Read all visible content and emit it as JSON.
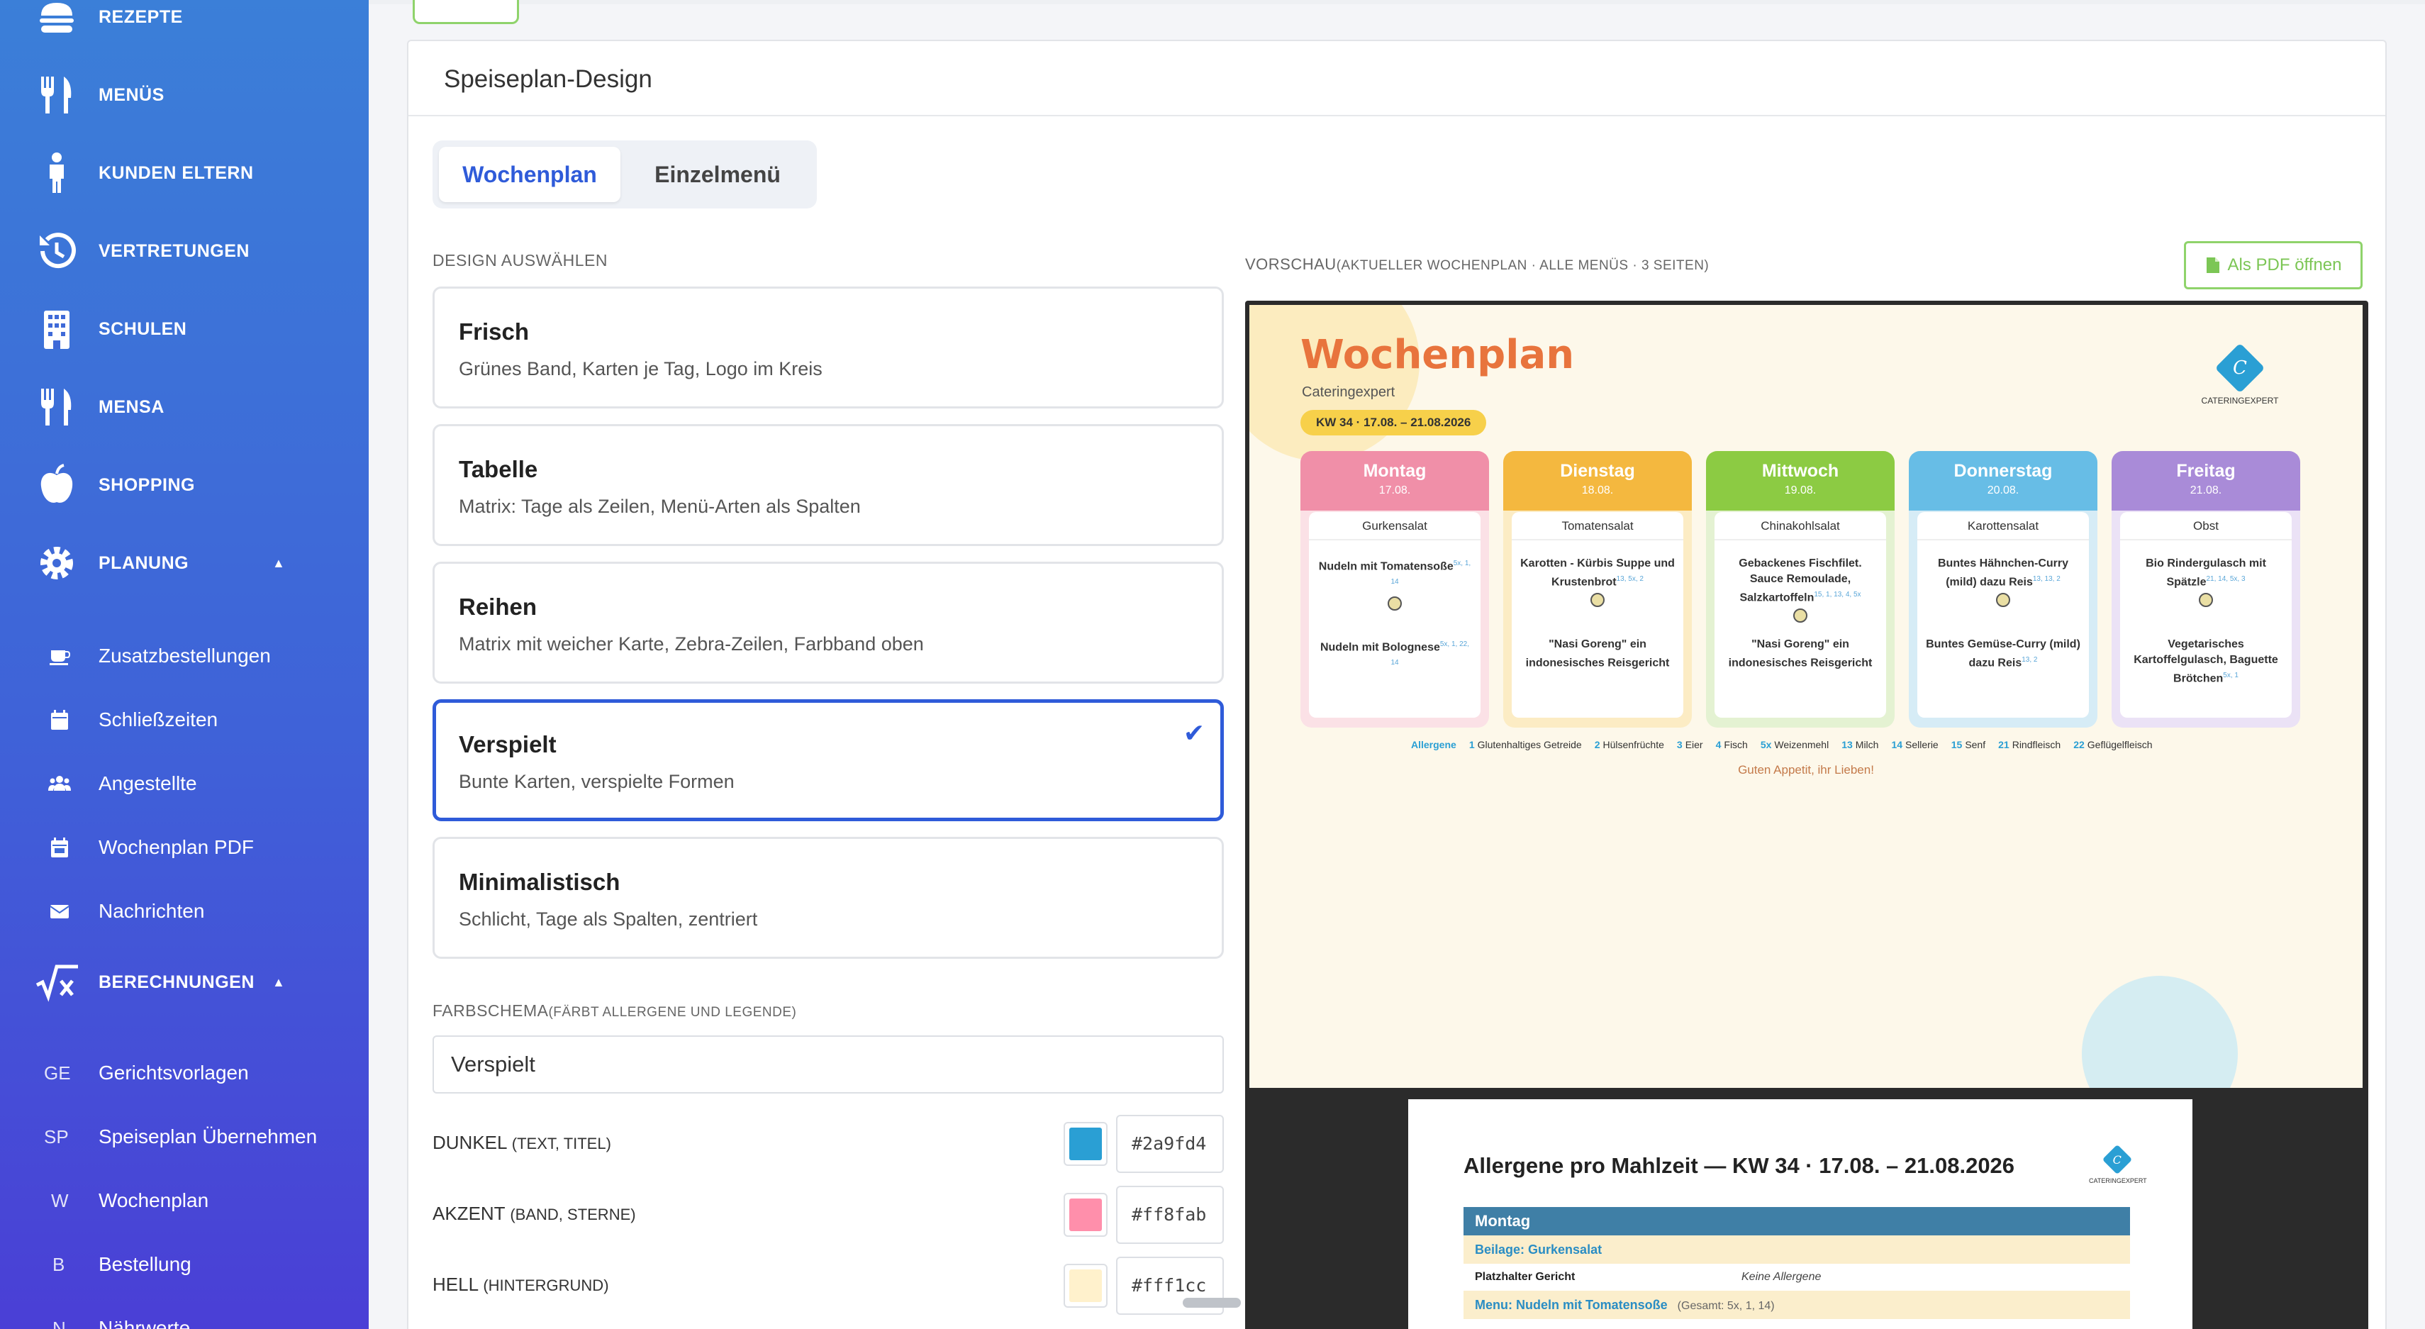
{
  "sidebar": {
    "top_items": [
      {
        "label": "REZEPTE",
        "icon": "burger-icon"
      },
      {
        "label": "MENÜS",
        "icon": "fork-knife-icon"
      },
      {
        "label": "KUNDEN ELTERN",
        "icon": "child-icon"
      },
      {
        "label": "VERTRETUNGEN",
        "icon": "history-icon"
      },
      {
        "label": "SCHULEN",
        "icon": "building-icon"
      },
      {
        "label": "MENSA",
        "icon": "fork-knife-icon"
      },
      {
        "label": "SHOPPING",
        "icon": "apple-icon"
      },
      {
        "label": "PLANUNG",
        "icon": "gear-icon"
      }
    ],
    "planung_items": [
      {
        "label": "Zusatzbestellungen",
        "icon": "cup-icon"
      },
      {
        "label": "Schließzeiten",
        "icon": "calendar-icon"
      },
      {
        "label": "Angestellte",
        "icon": "users-icon"
      },
      {
        "label": "Wochenplan PDF",
        "icon": "calendar-icon"
      },
      {
        "label": "Nachrichten",
        "icon": "envelope-icon"
      }
    ],
    "berechnungen": {
      "label": "BERECHNUNGEN",
      "icon": "sqrt-x-icon"
    },
    "berechnungen_items": [
      {
        "abbr": "GE",
        "label": "Gerichtsvorlagen"
      },
      {
        "abbr": "SP",
        "label": "Speiseplan Übernehmen"
      },
      {
        "abbr": "W",
        "label": "Wochenplan"
      },
      {
        "abbr": "B",
        "label": "Bestellung"
      },
      {
        "abbr": "N",
        "label": "Nährwerte"
      }
    ]
  },
  "card": {
    "title": "Speiseplan-Design",
    "tabs": {
      "wochenplan": "Wochenplan",
      "einzelmenu": "Einzelmenü"
    },
    "design_label": "DESIGN AUSWÄHLEN",
    "designs": [
      {
        "name": "Frisch",
        "desc": "Grünes Band, Karten je Tag, Logo im Kreis"
      },
      {
        "name": "Tabelle",
        "desc": "Matrix: Tage als Zeilen, Menü-Arten als Spalten"
      },
      {
        "name": "Reihen",
        "desc": "Matrix mit weicher Karte, Zebra-Zeilen, Farbband oben"
      },
      {
        "name": "Verspielt",
        "desc": "Bunte Karten, verspielte Formen",
        "check": "✔"
      },
      {
        "name": "Minimalistisch",
        "desc": "Schlicht, Tage als Spalten, zentriert"
      }
    ],
    "farbschema_label": "FARBSCHEMA",
    "farbschema_hint": "(FÄRBT ALLERGENE UND LEGENDE)",
    "farbschema_value": "Verspielt",
    "colors": [
      {
        "label": "DUNKEL",
        "hint": "(TEXT, TITEL)",
        "hex": "#2a9fd4"
      },
      {
        "label": "AKZENT",
        "hint": "(BAND, STERNE)",
        "hex": "#ff8fab"
      },
      {
        "label": "HELL",
        "hint": "(HINTERGRUND)",
        "hex": "#fff1cc"
      }
    ]
  },
  "preview": {
    "label": "VORSCHAU",
    "hint": "(AKTUELLER WOCHENPLAN · ALLE MENÜS · 3 SEITEN)",
    "pdf_button": "Als PDF öffnen",
    "page1": {
      "title": "Wochenplan",
      "subtitle": "Cateringexpert",
      "kw": "KW 34 · 17.08. – 21.08.2026",
      "logo_letter": "C",
      "logo_text": "CATERINGEXPERT",
      "days": [
        {
          "name": "Montag",
          "date": "17.08.",
          "color": "#f08fa8",
          "bg": "#fbe1e6",
          "side": "Gurkensalat",
          "meal1": "Nudeln mit Tomatensoße",
          "meal1_allergens": "5x, 1, 14",
          "meal2": "Nudeln mit Bolognese",
          "meal2_allergens": "5x, 1, 22, 14"
        },
        {
          "name": "Dienstag",
          "date": "18.08.",
          "color": "#f4b83f",
          "bg": "#fcecc4",
          "side": "Tomatensalat",
          "meal1": "Karotten - Kürbis Suppe und Krustenbrot",
          "meal1_allergens": "13, 5x, 2",
          "meal2": "\"Nasi Goreng\" ein indonesisches Reisgericht",
          "meal2_allergens": ""
        },
        {
          "name": "Mittwoch",
          "date": "19.08.",
          "color": "#8ccb43",
          "bg": "#e4f2d2",
          "side": "Chinakohlsalat",
          "meal1": "Gebackenes Fischfilet. Sauce Remoulade, Salzkartoffeln",
          "meal1_allergens": "15, 1, 13, 4, 5x",
          "meal2": "\"Nasi Goreng\" ein indonesisches Reisgericht",
          "meal2_allergens": ""
        },
        {
          "name": "Donnerstag",
          "date": "20.08.",
          "color": "#67bde6",
          "bg": "#d6ecf6",
          "side": "Karottensalat",
          "meal1": "Buntes Hähnchen-Curry (mild) dazu Reis",
          "meal1_allergens": "13, 13, 2",
          "meal2": "Buntes Gemüse-Curry (mild) dazu Reis",
          "meal2_allergens": "13, 2"
        },
        {
          "name": "Freitag",
          "date": "21.08.",
          "color": "#a98bd8",
          "bg": "#ebe2f6",
          "side": "Obst",
          "meal1": "Bio Rindergulasch mit Spätzle",
          "meal1_allergens": "21, 14, 5x, 3",
          "meal2": "Vegetarisches Kartoffelgulasch, Baguette Brötchen",
          "meal2_allergens": "5x, 1"
        }
      ],
      "legend_title": "Allergene",
      "legend": [
        {
          "code": "1",
          "name": "Glutenhaltiges Getreide"
        },
        {
          "code": "2",
          "name": "Hülsenfrüchte"
        },
        {
          "code": "3",
          "name": "Eier"
        },
        {
          "code": "4",
          "name": "Fisch"
        },
        {
          "code": "5x",
          "name": "Weizenmehl"
        },
        {
          "code": "13",
          "name": "Milch"
        },
        {
          "code": "14",
          "name": "Sellerie"
        },
        {
          "code": "15",
          "name": "Senf"
        },
        {
          "code": "21",
          "name": "Rindfleisch"
        },
        {
          "code": "22",
          "name": "Geflügelfleisch"
        }
      ],
      "greeting": "Guten Appetit, ihr Lieben!"
    },
    "page2": {
      "title": "Allergene pro Mahlzeit — KW 34 · 17.08. – 21.08.2026",
      "logo_letter": "C",
      "logo_text": "CATERINGEXPERT",
      "day": "Montag",
      "rows": [
        {
          "label": "Beilage: Gurkensalat"
        },
        {
          "label": "Platzhalter Gericht",
          "note": "Keine Allergene"
        },
        {
          "label": "Menu: Nudeln mit Tomatensoße",
          "total": "(Gesamt: 5x, 1, 14)"
        }
      ]
    }
  }
}
